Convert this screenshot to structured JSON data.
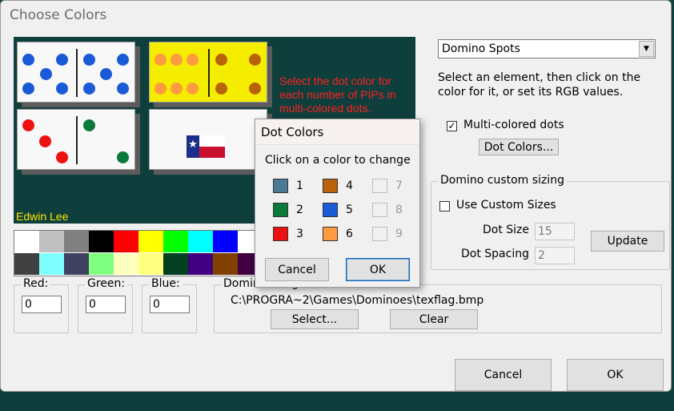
{
  "window": {
    "title": "Choose Colors"
  },
  "preview": {
    "instruction": "Select the dot color for each number of PIPs in multi-colored dots.",
    "author": "Edwin Lee"
  },
  "element_select": {
    "value": "Domino Spots"
  },
  "help_text": "Select an element, then click on the color for it, or set its RGB values.",
  "multicolor": {
    "label": "Multi-colored dots",
    "checked": "✓"
  },
  "dot_colors_button": "Dot Colors...",
  "custom_sizing": {
    "legend": "Domino custom sizing",
    "use_label": "Use Custom Sizes",
    "dot_size_label": "Dot Size",
    "dot_size_value": "15",
    "dot_spacing_label": "Dot Spacing",
    "dot_spacing_value": "2",
    "update_button": "Update"
  },
  "palette": {
    "row1": [
      "#ffffff",
      "#c0c0c0",
      "#808080",
      "#000000",
      "#ff0000",
      "#ffff00",
      "#00ff00",
      "#00ffff",
      "#0000ff"
    ],
    "row2": [
      "#404040",
      "#80ffff",
      "#404060",
      "#80ff80",
      "#ffffc0",
      "#ffff80",
      "#004020",
      "#400080",
      "#804000",
      "#400040"
    ]
  },
  "rgb": {
    "red_label": "Red:",
    "red_value": "0",
    "green_label": "Green:",
    "green_value": "0",
    "blue_label": "Blue:",
    "blue_value": "0"
  },
  "domino_image": {
    "legend": "Domino Image",
    "path": "C:\\PROGRA~2\\Games\\Dominoes\\texflag.bmp",
    "select_button": "Select...",
    "clear_button": "Clear"
  },
  "footer": {
    "cancel": "Cancel",
    "ok": "OK"
  },
  "dot_colors_dialog": {
    "title": "Dot Colors",
    "prompt": "Click on a color to change",
    "items": [
      {
        "n": "1",
        "color": "#4a7a95"
      },
      {
        "n": "2",
        "color": "#0a7a3a"
      },
      {
        "n": "3",
        "color": "#ee1111"
      },
      {
        "n": "4",
        "color": "#b8620a"
      },
      {
        "n": "5",
        "color": "#1a5ad6"
      },
      {
        "n": "6",
        "color": "#ff9a40"
      },
      {
        "n": "7",
        "color": ""
      },
      {
        "n": "8",
        "color": ""
      },
      {
        "n": "9",
        "color": ""
      }
    ],
    "cancel": "Cancel",
    "ok": "OK"
  },
  "colors": {
    "accent": "#0a64b4",
    "felt": "#0e3f3c",
    "instruction_text": "#ff2020",
    "author_text": "#ffe800"
  }
}
